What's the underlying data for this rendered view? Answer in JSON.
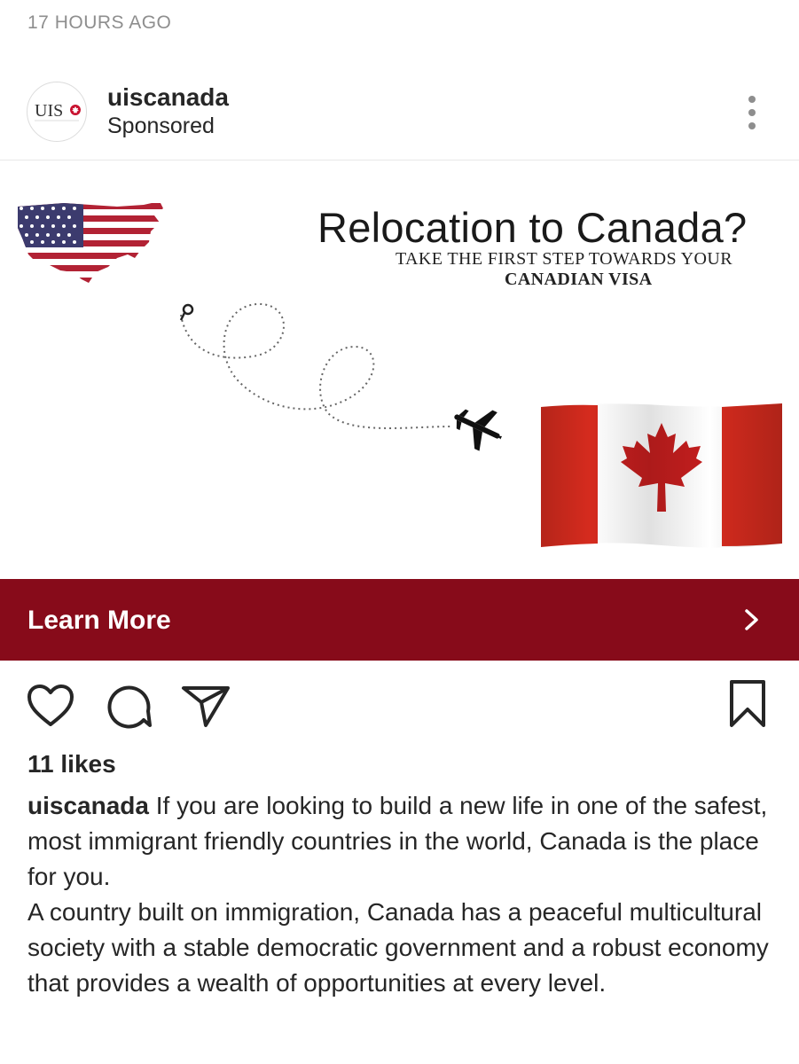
{
  "post": {
    "timestamp": "17 HOURS AGO",
    "username": "uiscanada",
    "sponsored_label": "Sponsored",
    "avatar_logo_text": "UIS"
  },
  "ad": {
    "headline": "Relocation to Canada?",
    "subline1": "TAKE THE FIRST STEP TOWARDS YOUR",
    "subline2": "CANADIAN VISA",
    "cta_label": "Learn More",
    "cta_color": "#870b1a"
  },
  "actions": {
    "like_icon": "heart-icon",
    "comment_icon": "comment-icon",
    "share_icon": "share-icon",
    "save_icon": "bookmark-icon"
  },
  "likes_text": "11 likes",
  "caption": {
    "username": "uiscanada",
    "paragraph1": "If you are looking to build a new life in one of the safest, most immigrant friendly countries in the world, Canada is the place for you.",
    "paragraph2": "A country built on immigration, Canada has a peaceful multicultural society with a stable democratic government and a robust economy that provides a wealth of opportunities at every level."
  }
}
